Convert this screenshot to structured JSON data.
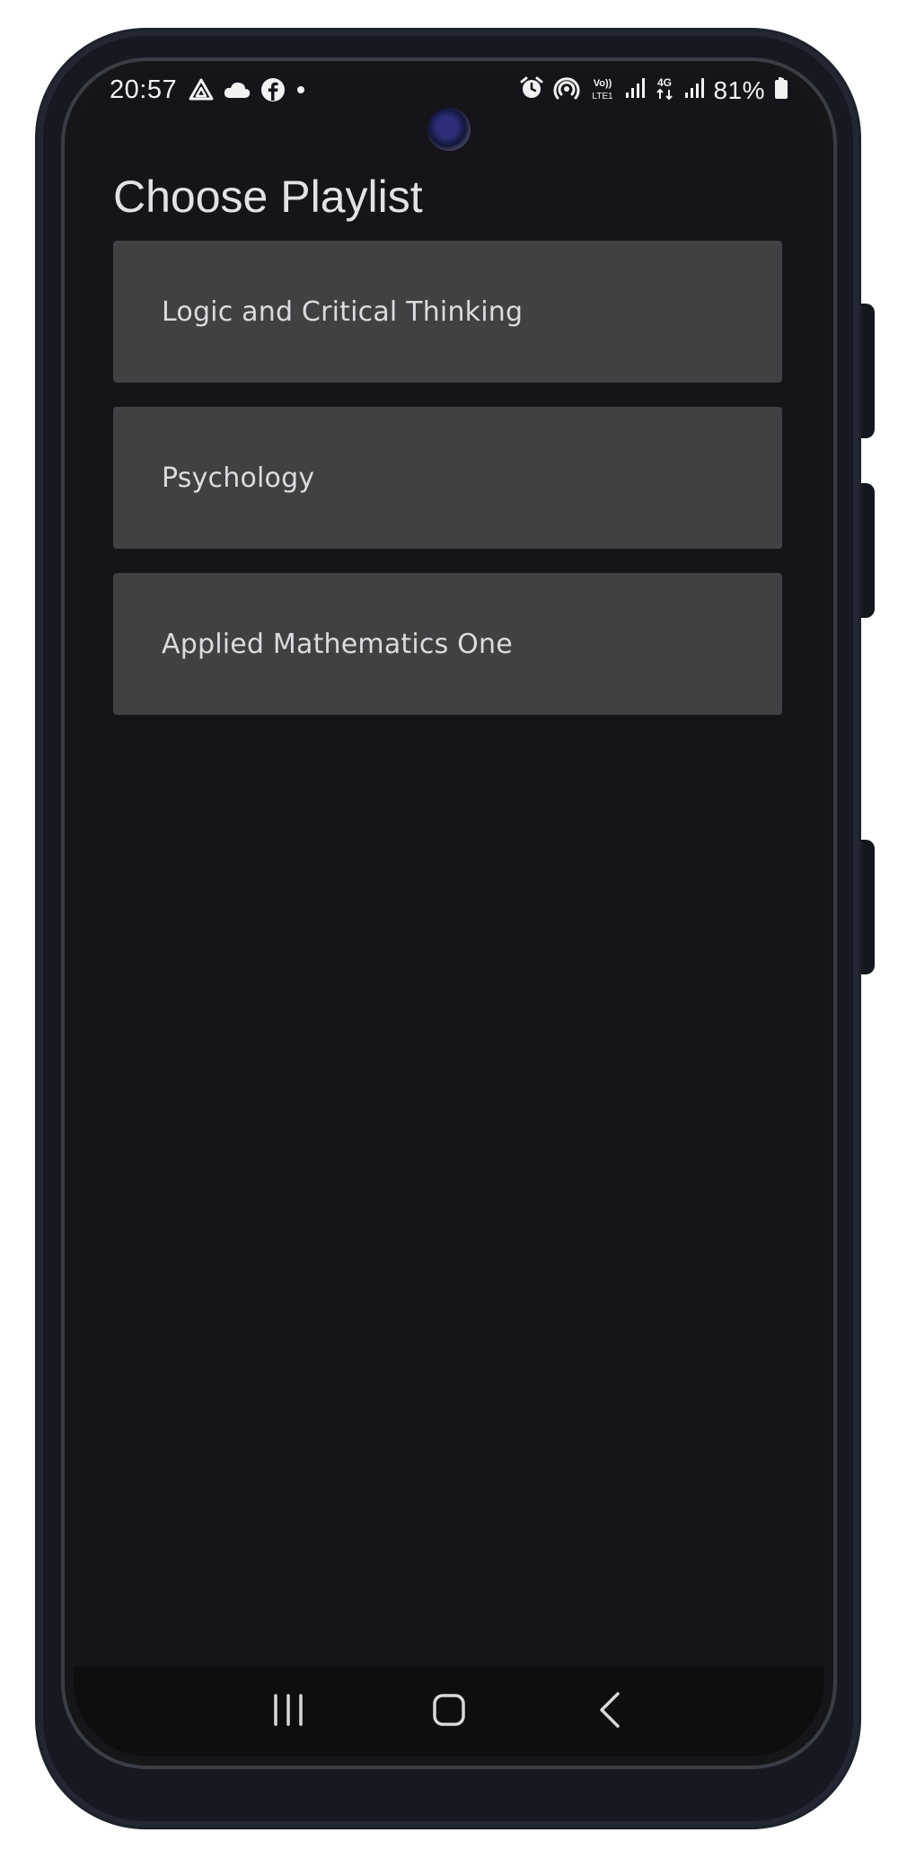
{
  "status_bar": {
    "time": "20:57",
    "left_icons": [
      "drive-icon",
      "cloud-icon",
      "facebook-icon",
      "dot-icon"
    ],
    "right_icons": [
      "alarm-icon",
      "hotspot-icon",
      "volte-icon",
      "signal-icon",
      "4g-icon",
      "signal-icon",
      "battery-icon"
    ],
    "volte_label": "Vo)) LTE1",
    "network_label": "4G",
    "battery_percent": "81%"
  },
  "page": {
    "title": "Choose Playlist"
  },
  "playlists": [
    {
      "label": "Logic and Critical Thinking"
    },
    {
      "label": "Psychology"
    },
    {
      "label": "Applied Mathematics One"
    }
  ],
  "nav_bar": {
    "buttons": [
      "recent-apps-icon",
      "home-icon",
      "back-icon"
    ]
  },
  "colors": {
    "background": "#16141a",
    "card": "#414042",
    "title_text": "#e4e0e8",
    "card_text": "#dcdbe0",
    "nav_bar": "#0e0e10"
  }
}
